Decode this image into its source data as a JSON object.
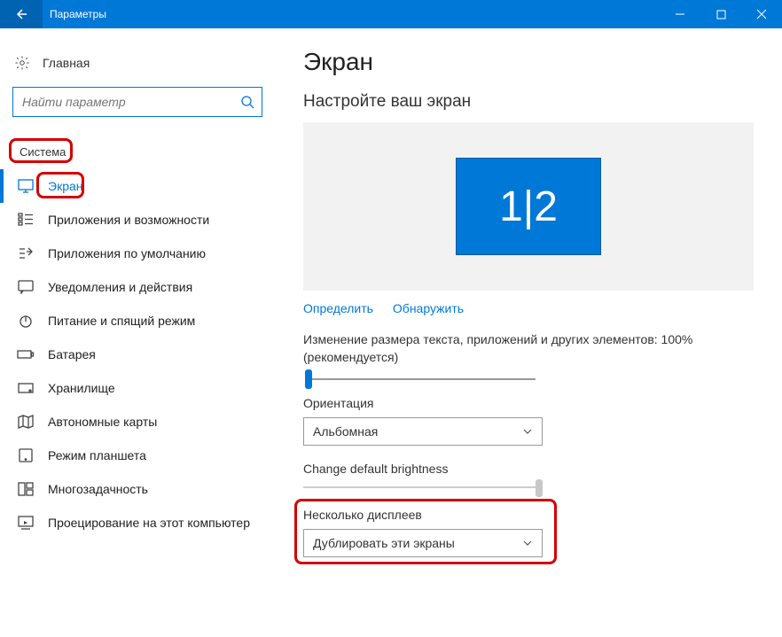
{
  "titlebar": {
    "title": "Параметры"
  },
  "sidebar": {
    "home_label": "Главная",
    "search_placeholder": "Найти параметр",
    "category_label": "Система",
    "items": [
      {
        "label": "Экран"
      },
      {
        "label": "Приложения и возможности"
      },
      {
        "label": "Приложения по умолчанию"
      },
      {
        "label": "Уведомления и действия"
      },
      {
        "label": "Питание и спящий режим"
      },
      {
        "label": "Батарея"
      },
      {
        "label": "Хранилище"
      },
      {
        "label": "Автономные карты"
      },
      {
        "label": "Режим планшета"
      },
      {
        "label": "Многозадачность"
      },
      {
        "label": "Проецирование на этот компьютер"
      }
    ]
  },
  "main": {
    "heading": "Экран",
    "subtitle": "Настройте ваш экран",
    "display_merged_label": "1|2",
    "identify_label": "Определить",
    "detect_label": "Обнаружить",
    "scale_label": "Изменение размера текста, приложений и других элементов: 100% (рекомендуется)",
    "orientation_label": "Ориентация",
    "orientation_value": "Альбомная",
    "brightness_label": "Change default brightness",
    "multi_display_label": "Несколько дисплеев",
    "multi_display_value": "Дублировать эти экраны"
  }
}
